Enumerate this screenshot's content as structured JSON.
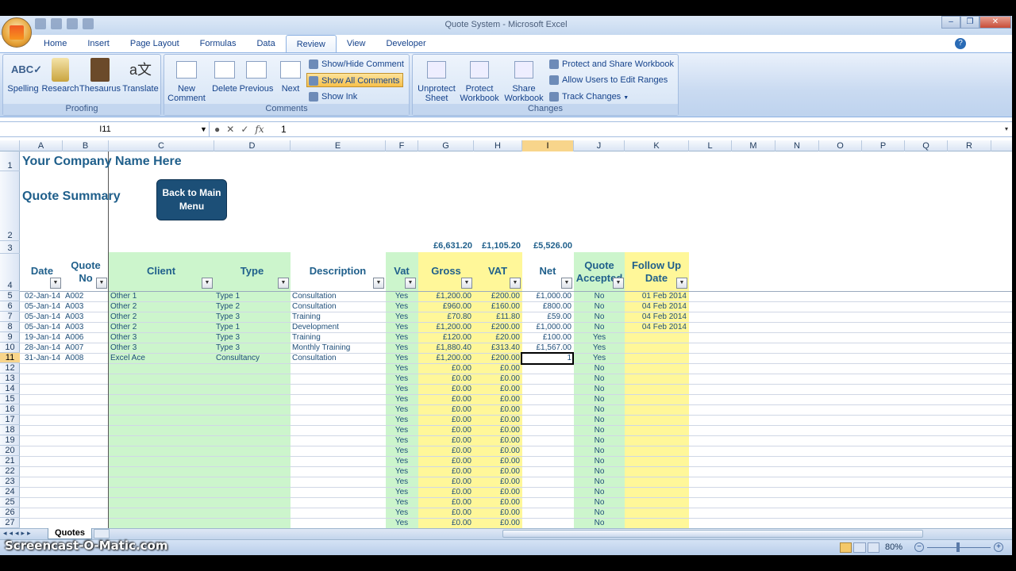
{
  "window": {
    "title": "Quote System - Microsoft Excel"
  },
  "ribbon_tabs": [
    "Home",
    "Insert",
    "Page Layout",
    "Formulas",
    "Data",
    "Review",
    "View",
    "Developer"
  ],
  "active_tab": "Review",
  "groups": {
    "proofing": {
      "label": "Proofing",
      "buttons": [
        "Spelling",
        "Research",
        "Thesaurus",
        "Translate"
      ]
    },
    "comments": {
      "label": "Comments",
      "new_line1": "New",
      "new_line2": "Comment",
      "delete": "Delete",
      "previous": "Previous",
      "next": "Next",
      "show_hide": "Show/Hide Comment",
      "show_all": "Show All Comments",
      "show_ink": "Show Ink"
    },
    "changes": {
      "label": "Changes",
      "unprotect_1": "Unprotect",
      "unprotect_2": "Sheet",
      "protect_1": "Protect",
      "protect_2": "Workbook",
      "share_1": "Share",
      "share_2": "Workbook",
      "protect_share": "Protect and Share Workbook",
      "allow_users": "Allow Users to Edit Ranges",
      "track": "Track Changes"
    }
  },
  "formula_bar": {
    "name_box": "I11",
    "value": "1"
  },
  "columns": [
    "A",
    "B",
    "C",
    "D",
    "E",
    "F",
    "G",
    "H",
    "I",
    "J",
    "K",
    "L",
    "M",
    "N",
    "O",
    "P",
    "Q",
    "R"
  ],
  "rows": [
    "1",
    "2",
    "3",
    "4",
    "5",
    "6",
    "7",
    "8",
    "9",
    "10",
    "11",
    "12",
    "13",
    "14",
    "15",
    "16",
    "17",
    "18",
    "19",
    "20",
    "21",
    "22",
    "23",
    "24",
    "25",
    "26",
    "27"
  ],
  "sheet": {
    "company": "Your Company Name Here",
    "summary": "Quote Summary",
    "back_button_1": "Back to Main",
    "back_button_2": "Menu",
    "totals": {
      "gross": "£6,631.20",
      "vat": "£1,105.20",
      "net": "£5,526.00"
    },
    "headers": {
      "date": "Date",
      "quote1": "Quote",
      "quote2": "No",
      "client": "Client",
      "type": "Type",
      "description": "Description",
      "vat": "Vat",
      "gross": "Gross",
      "vat_amt": "VAT",
      "net": "Net",
      "accepted1": "Quote",
      "accepted2": "Accepted",
      "follow1": "Follow Up",
      "follow2": "Date"
    },
    "data": [
      {
        "date": "02-Jan-14",
        "quote": "A002",
        "client": "Other 1",
        "type": "Type 1",
        "desc": "Consultation",
        "vat": "Yes",
        "gross": "£1,200.00",
        "vatamt": "£200.00",
        "net": "£1,000.00",
        "acc": "No",
        "follow": "01 Feb 2014"
      },
      {
        "date": "05-Jan-14",
        "quote": "A003",
        "client": "Other 2",
        "type": "Type 2",
        "desc": "Consultation",
        "vat": "Yes",
        "gross": "£960.00",
        "vatamt": "£160.00",
        "net": "£800.00",
        "acc": "No",
        "follow": "04 Feb 2014"
      },
      {
        "date": "05-Jan-14",
        "quote": "A003",
        "client": "Other 2",
        "type": "Type 3",
        "desc": "Training",
        "vat": "Yes",
        "gross": "£70.80",
        "vatamt": "£11.80",
        "net": "£59.00",
        "acc": "No",
        "follow": "04 Feb 2014"
      },
      {
        "date": "05-Jan-14",
        "quote": "A003",
        "client": "Other 2",
        "type": "Type 1",
        "desc": "Development",
        "vat": "Yes",
        "gross": "£1,200.00",
        "vatamt": "£200.00",
        "net": "£1,000.00",
        "acc": "No",
        "follow": "04 Feb 2014"
      },
      {
        "date": "19-Jan-14",
        "quote": "A006",
        "client": "Other 3",
        "type": "Type 3",
        "desc": "Training",
        "vat": "Yes",
        "gross": "£120.00",
        "vatamt": "£20.00",
        "net": "£100.00",
        "acc": "Yes",
        "follow": ""
      },
      {
        "date": "28-Jan-14",
        "quote": "A007",
        "client": "Other 3",
        "type": "Type 3",
        "desc": "Monthly Training",
        "vat": "Yes",
        "gross": "£1,880.40",
        "vatamt": "£313.40",
        "net": "£1,567.00",
        "acc": "Yes",
        "follow": ""
      },
      {
        "date": "31-Jan-14",
        "quote": "A008",
        "client": "Excel Ace",
        "type": "Consultancy",
        "desc": "Consultation",
        "vat": "Yes",
        "gross": "£1,200.00",
        "vatamt": "£200.00",
        "net": "1",
        "acc": "Yes",
        "follow": ""
      }
    ],
    "empty": {
      "vat": "Yes",
      "gross": "£0.00",
      "vatamt": "£0.00",
      "acc": "No"
    }
  },
  "sheet_tab": "Quotes",
  "status": {
    "zoom": "80%"
  },
  "watermark": "Screencast-O-Matic.com"
}
